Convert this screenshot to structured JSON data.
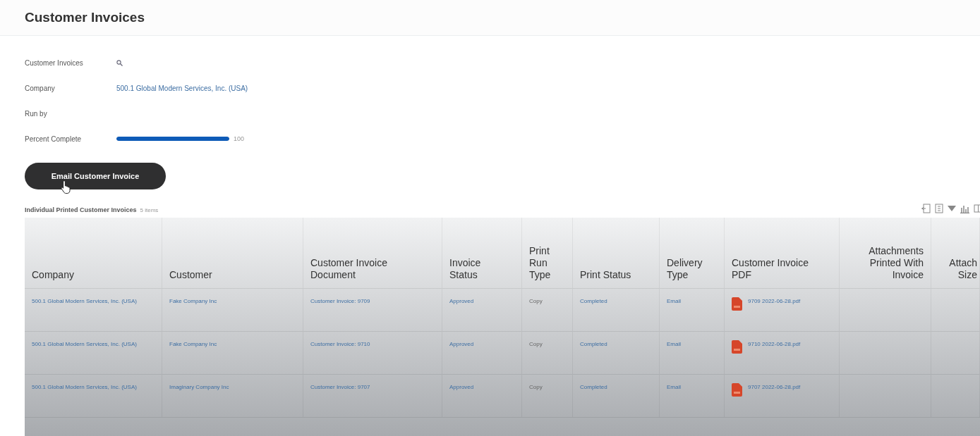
{
  "page_title": "Customer Invoices",
  "fields": [
    {
      "label": "Customer Invoices",
      "kind": "search"
    },
    {
      "label": "Company",
      "kind": "link",
      "value": "500.1 Global Modern Services, Inc. (USA)"
    },
    {
      "label": "Run by",
      "kind": "text"
    },
    {
      "label": "Percent Complete",
      "kind": "progress",
      "level": 1,
      "reading": "100"
    }
  ],
  "action_button": "Email Customer Invoice",
  "table": {
    "title": "Individual Printed Customer Invoices",
    "count": "5 items",
    "columns": [
      {
        "lines": [
          "Company"
        ],
        "kind": "link"
      },
      {
        "lines": [
          "Customer"
        ],
        "kind": "link"
      },
      {
        "lines": [
          "Customer Invoice",
          "Document"
        ],
        "kind": "link"
      },
      {
        "lines": [
          "Invoice",
          "Status"
        ],
        "kind": "link"
      },
      {
        "lines": [
          "Print",
          "Run",
          "Type"
        ],
        "kind": "text"
      },
      {
        "lines": [
          "Print Status"
        ],
        "kind": "link"
      },
      {
        "lines": [
          "Delivery",
          "Type"
        ],
        "kind": "link"
      },
      {
        "lines": [
          "Customer Invoice",
          "PDF"
        ],
        "kind": "pdf"
      },
      {
        "lines": [
          "Attachments",
          "Printed With",
          "Invoice"
        ],
        "kind": "numeric"
      },
      {
        "lines": [
          "Attach",
          "Size"
        ],
        "kind": "numeric"
      }
    ],
    "rows": [
      [
        "500.1 Global Modern Services, Inc. (USA)",
        "Fake Company Inc",
        "Customer Invoice: 9709",
        "Approved",
        "Copy",
        "Completed",
        "Email",
        "9709 2022-06-28.pdf",
        "",
        ""
      ],
      [
        "500.1 Global Modern Services, Inc. (USA)",
        "Fake Company Inc",
        "Customer Invoice: 9710",
        "Approved",
        "Copy",
        "Completed",
        "Email",
        "9710 2022-06-28.pdf",
        "",
        ""
      ],
      [
        "500.1 Global Modern Services, Inc. (USA)",
        "Imaginary Company Inc",
        "Customer Invoice: 9707",
        "Approved",
        "Copy",
        "Completed",
        "Email",
        "9707 2022-06-28.pdf",
        "",
        ""
      ]
    ]
  }
}
